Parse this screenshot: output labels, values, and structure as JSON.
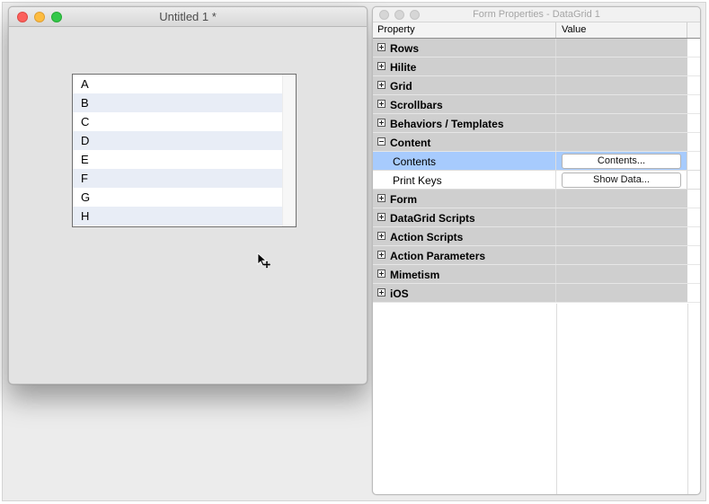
{
  "left_window": {
    "title": "Untitled 1 *",
    "datagrid_rows": [
      "A",
      "B",
      "C",
      "D",
      "E",
      "F",
      "G",
      "H"
    ]
  },
  "right_window": {
    "title": "Form Properties - DataGrid 1",
    "columns": {
      "property": "Property",
      "value": "Value"
    },
    "sections": {
      "rows": "Rows",
      "hilite": "Hilite",
      "grid": "Grid",
      "scrollbars": "Scrollbars",
      "behaviors": "Behaviors / Templates",
      "content": "Content",
      "form": "Form",
      "datagrid_scripts": "DataGrid Scripts",
      "action_scripts": "Action Scripts",
      "action_parameters": "Action Parameters",
      "mimetism": "Mimetism",
      "ios": "iOS"
    },
    "content_items": {
      "contents_label": "Contents",
      "contents_button": "Contents...",
      "print_keys_label": "Print Keys",
      "show_data_button": "Show Data..."
    }
  },
  "colors": {
    "section_bg": "#cfcfcf",
    "selected_bg": "#a7cbfd",
    "alt_row_bg": "#e8edf6"
  }
}
